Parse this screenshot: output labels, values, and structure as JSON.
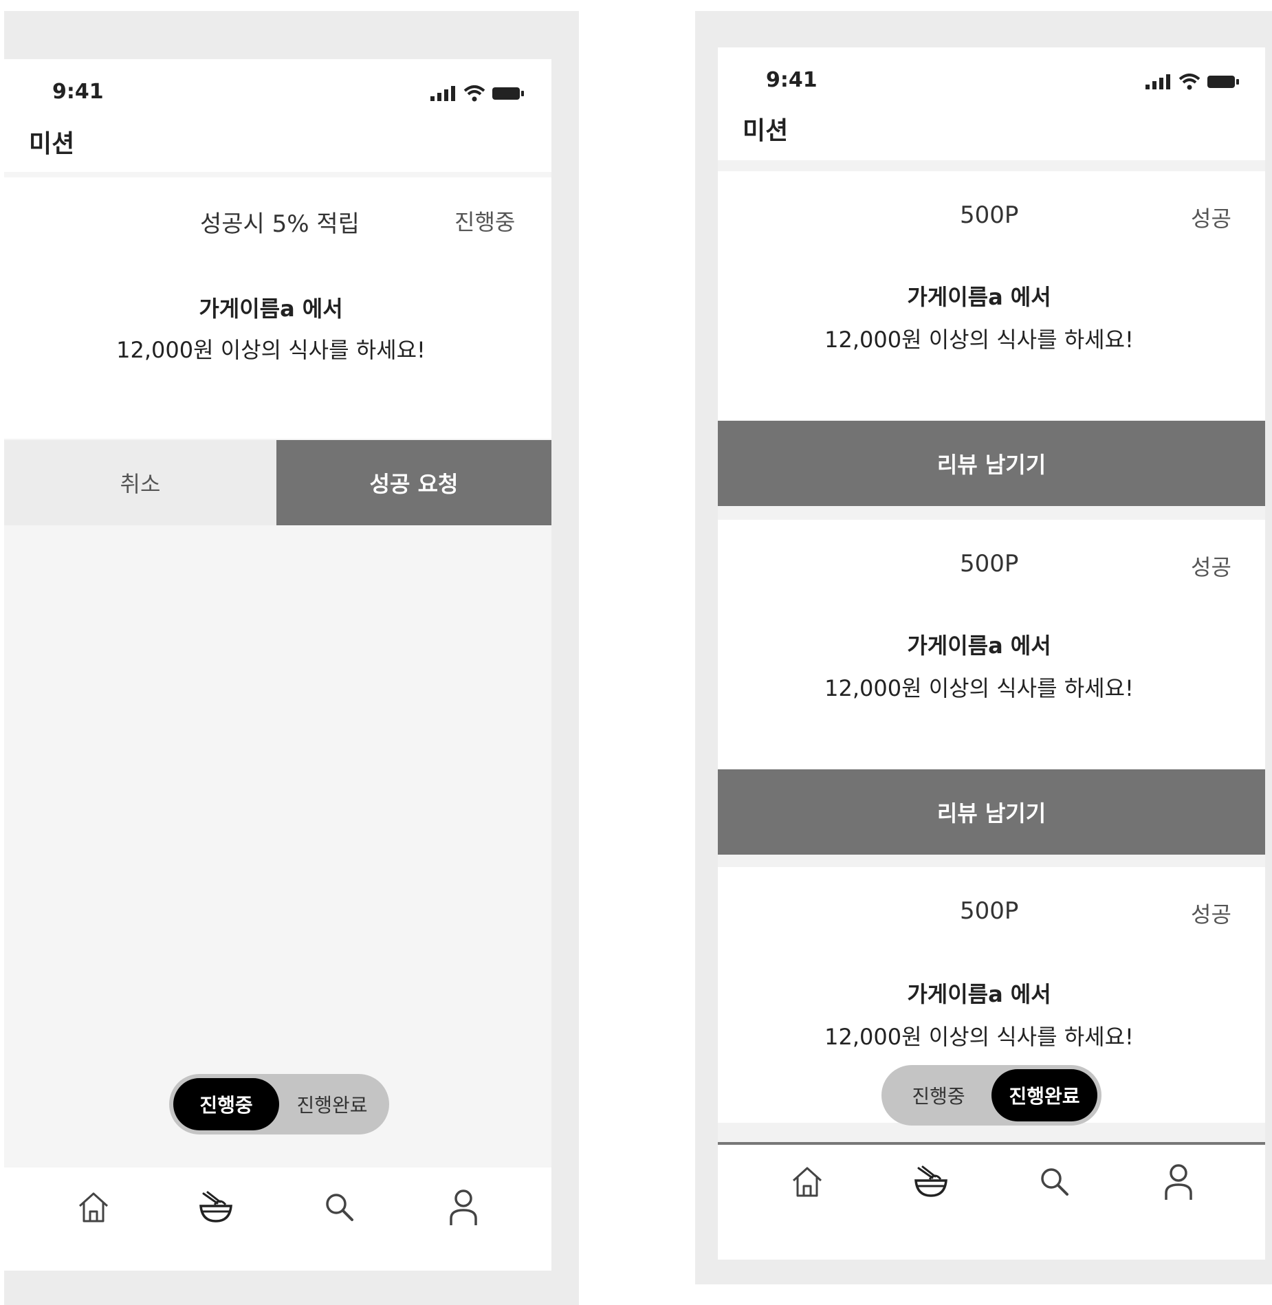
{
  "status_bar": {
    "time": "9:41"
  },
  "header": {
    "title": "미션"
  },
  "left_screen": {
    "card": {
      "points": "성공시 5% 적립",
      "status": "진행중",
      "store": "가게이름a 에서",
      "desc": "12,000원 이상의 식사를 하세요!"
    },
    "cancel_label": "취소",
    "request_label": "성공 요청",
    "toggle": {
      "option_1": "진행중",
      "option_2": "진행완료",
      "active": "option_1"
    }
  },
  "right_screen": {
    "cards": [
      {
        "points": "500P",
        "status": "성공",
        "store": "가게이름a 에서",
        "desc": "12,000원 이상의 식사를 하세요!",
        "button": "리뷰 남기기"
      },
      {
        "points": "500P",
        "status": "성공",
        "store": "가게이름a 에서",
        "desc": "12,000원 이상의 식사를 하세요!",
        "button": "리뷰 남기기"
      },
      {
        "points": "500P",
        "status": "성공",
        "store": "가게이름a 에서",
        "desc": "12,000원 이상의 식사를 하세요!"
      }
    ],
    "toggle": {
      "option_1": "진행중",
      "option_2": "진행완료",
      "active": "option_2"
    }
  },
  "tabbar": {
    "icons": [
      "home-icon",
      "food-bowl-icon",
      "search-icon",
      "profile-icon"
    ]
  },
  "colors": {
    "button_gray": "#737373",
    "toggle_active": "#000000",
    "toggle_bg": "#c4c4c4",
    "frame_bg": "#ececec"
  }
}
